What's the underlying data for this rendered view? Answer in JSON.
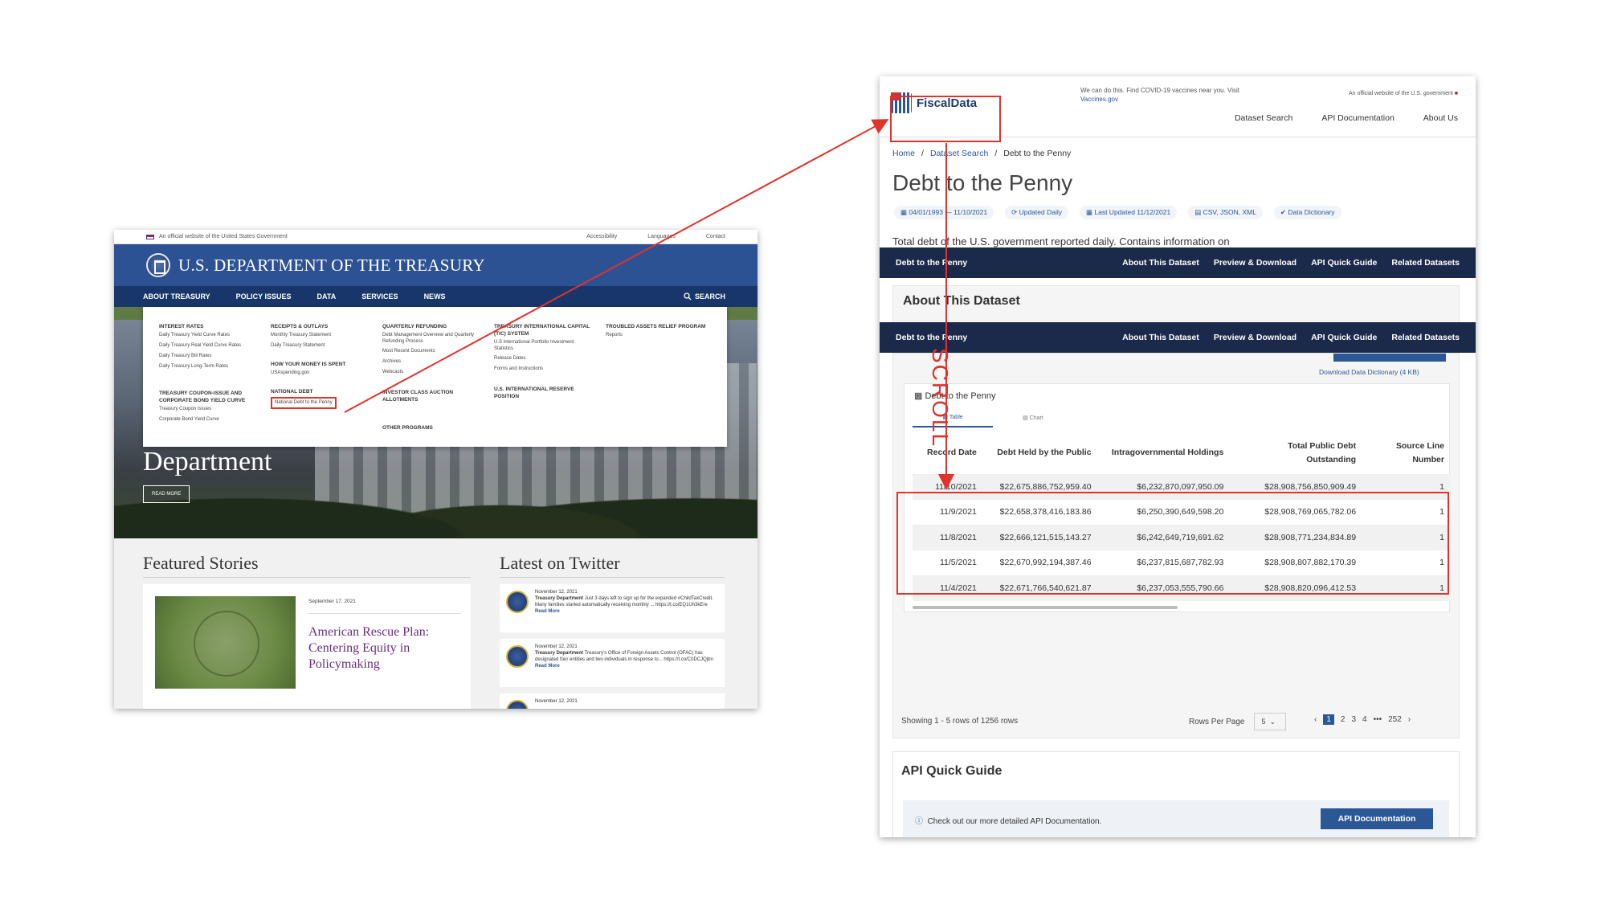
{
  "treasury": {
    "gov_banner": "An official website of the United States Government",
    "util_links": [
      "Accessibility",
      "Languages",
      "Contact"
    ],
    "title": "U.S. DEPARTMENT OF THE TREASURY",
    "nav": [
      "ABOUT TREASURY",
      "POLICY ISSUES",
      "DATA",
      "SERVICES",
      "NEWS"
    ],
    "search": "SEARCH",
    "mega": {
      "col1": {
        "h1": "INTEREST RATES",
        "items1": [
          "Daily Treasury Yield Curve Rates",
          "Daily Treasury Real Yield Curve Rates",
          "Daily Treasury Bill Rates",
          "Daily Treasury Long-Term Rates"
        ],
        "h2": "TREASURY COUPON-ISSUE AND CORPORATE BOND YIELD CURVE",
        "items2": [
          "Treasury Coupon Issues",
          "Corporate Bond Yield Curve"
        ]
      },
      "col2": {
        "h1": "RECEIPTS & OUTLAYS",
        "items1": [
          "Monthly Treasury Statement",
          "Daily Treasury Statement"
        ],
        "h2": "HOW YOUR MONEY IS SPENT",
        "items2": [
          "USAspending.gov"
        ],
        "h3": "NATIONAL DEBT",
        "items3": [
          "National Debt to the Penny"
        ]
      },
      "col3": {
        "h1": "QUARTERLY REFUNDING",
        "items1": [
          "Debt Management Overview and Quarterly Refunding Process",
          "Most Recent Documents",
          "Archives",
          "Webcasts"
        ],
        "h2": "INVESTOR CLASS AUCTION ALLOTMENTS",
        "h3": "OTHER PROGRAMS"
      },
      "col4": {
        "h1": "TREASURY INTERNATIONAL CAPITAL (TIC) SYSTEM",
        "items1": [
          "U.S International Portfolio Investment Statistics",
          "Release Dates",
          "Forms and Instructions"
        ],
        "h2": "U.S. INTERNATIONAL RESERVE POSITION"
      },
      "col5": {
        "h1": "TROUBLED ASSETS RELIEF PROGRAM",
        "items1": [
          "Reports"
        ]
      }
    },
    "hero_title": "Department",
    "read_more": "READ MORE",
    "featured_heading": "Featured Stories",
    "story": {
      "date": "September 17, 2021",
      "headline": "American Rescue Plan: Centering Equity in Policymaking"
    },
    "twitter_heading": "Latest on Twitter",
    "tweets": [
      {
        "date": "November 12, 2021",
        "author": "Treasury Department",
        "text": "Just 3 days left to sign up for the expanded #ChildTaxCredit. Many families started automatically receiving monthly ... https://t.co/EQ1Uh3kEre",
        "more": "Read More"
      },
      {
        "date": "November 12, 2021",
        "author": "Treasury Department",
        "text": "Treasury's Office of Foreign Assets Control (OFAC) has designated four entities and two individuals in response to... https://t.co/C0DCJQjbn",
        "more": "Read More"
      },
      {
        "date": "November 12, 2021"
      }
    ]
  },
  "fiscal": {
    "logo": "FiscalData",
    "covid": "We can do this. Find COVID-19 vaccines near you. Visit",
    "covid_link": "Vaccines.gov",
    "official": "An official website of the U.S. government",
    "nav": [
      "Dataset Search",
      "API Documentation",
      "About Us"
    ],
    "breadcrumb": [
      "Home",
      "Dataset Search",
      "Debt to the Penny"
    ],
    "title": "Debt to the Penny",
    "tags": [
      "04/01/1993 — 11/10/2021",
      "Updated Daily",
      "Last Updated 11/12/2021",
      "CSV, JSON, XML",
      "Data Dictionary"
    ],
    "description": "Total debt of the U.S. government reported daily. Contains information on intragovernmental holdings and debt held by the public.",
    "bar_title": "Debt to the Penny",
    "bar_links": [
      "About This Dataset",
      "Preview & Download",
      "API Quick Guide",
      "Related Datasets"
    ],
    "about_heading": "About This Dataset",
    "download_dict": "Download Data Dictionary (4 KB)",
    "table_caption": "Debt to the Penny",
    "tabs": [
      "Table",
      "Chart"
    ],
    "columns": [
      "Record Date",
      "Debt Held by the Public",
      "Intragovernmental Holdings",
      "Total Public Debt Outstanding",
      "Source Line Number"
    ],
    "rows": [
      [
        "11/10/2021",
        "$22,675,886,752,959.40",
        "$6,232,870,097,950.09",
        "$28,908,756,850,909.49",
        "1"
      ],
      [
        "11/9/2021",
        "$22,658,378,416,183.86",
        "$6,250,390,649,598.20",
        "$28,908,769,065,782.06",
        "1"
      ],
      [
        "11/8/2021",
        "$22,666,121,515,143.27",
        "$6,242,649,719,691.62",
        "$28,908,771,234,834.89",
        "1"
      ],
      [
        "11/5/2021",
        "$22,670,992,194,387.46",
        "$6,237,815,687,782.93",
        "$28,908,807,882,170.39",
        "1"
      ],
      [
        "11/4/2021",
        "$22,671,766,540,621.87",
        "$6,237,053,555,790.66",
        "$28,908,820,096,412.53",
        "1"
      ]
    ],
    "showing": "Showing 1 - 5 rows of 1256 rows",
    "rows_per_page_label": "Rows Per Page",
    "rows_per_page": "5",
    "pages": [
      "1",
      "2",
      "3",
      "4",
      "•••",
      "252"
    ],
    "api_heading": "API Quick Guide",
    "api_info": "Check out our more detailed API Documentation.",
    "api_button": "API Documentation"
  },
  "annotation": {
    "scroll_label": "SCROLL",
    "color": "#e0332c"
  }
}
